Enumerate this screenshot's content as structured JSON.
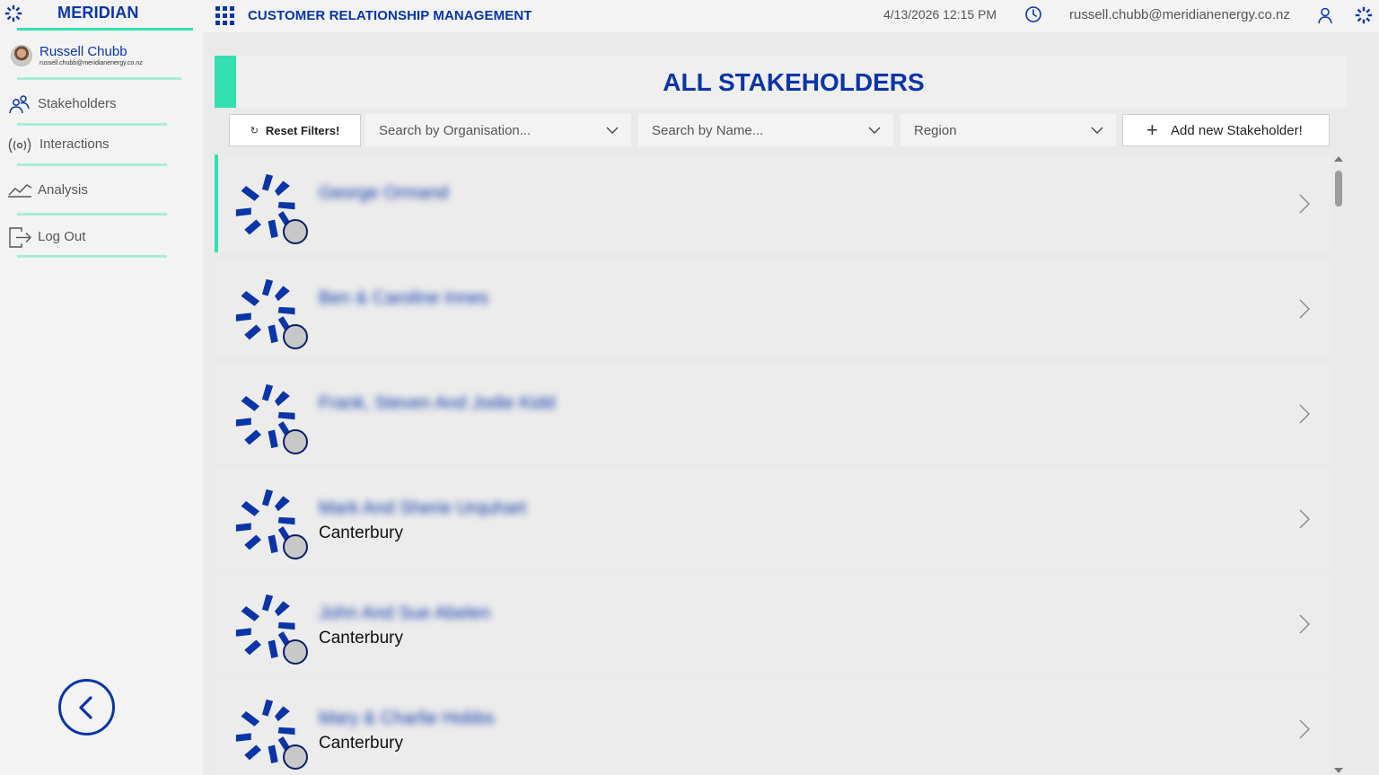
{
  "brand": {
    "name": "MERIDIAN"
  },
  "user": {
    "name": "Russell Chubb",
    "email": "russell.chubb@meridianenergy.co.nz"
  },
  "nav": [
    {
      "label": "Stakeholders",
      "icon": "people-icon"
    },
    {
      "label": "Interactions",
      "icon": "broadcast-icon"
    },
    {
      "label": "Analysis",
      "icon": "line-chart-icon"
    },
    {
      "label": "Log Out",
      "icon": "logout-icon"
    }
  ],
  "header": {
    "app_title": "CUSTOMER RELATIONSHIP MANAGEMENT",
    "datetime": "4/13/2026 12:15 PM",
    "email": "russell.chubb@meridianenergy.co.nz"
  },
  "page": {
    "title": "ALL STAKEHOLDERS"
  },
  "filters": {
    "reset_label": "Reset Filters!",
    "organisation_placeholder": "Search by Organisation...",
    "name_placeholder": "Search by Name...",
    "region_placeholder": "Region",
    "add_label": "Add new Stakeholder!"
  },
  "stakeholders": [
    {
      "name": "George Ormand",
      "region": ""
    },
    {
      "name": "Ben & Caroline Innes",
      "region": ""
    },
    {
      "name": "Frank, Steven And Jodie Kidd",
      "region": ""
    },
    {
      "name": "Mark And Sherie Urquhart",
      "region": "Canterbury"
    },
    {
      "name": "John And Sue Abelen",
      "region": "Canterbury"
    },
    {
      "name": "Mary & Charlie Hobbs",
      "region": "Canterbury"
    }
  ],
  "colors": {
    "brand_blue": "#0a35a8",
    "accent_green": "#35e0b0"
  }
}
